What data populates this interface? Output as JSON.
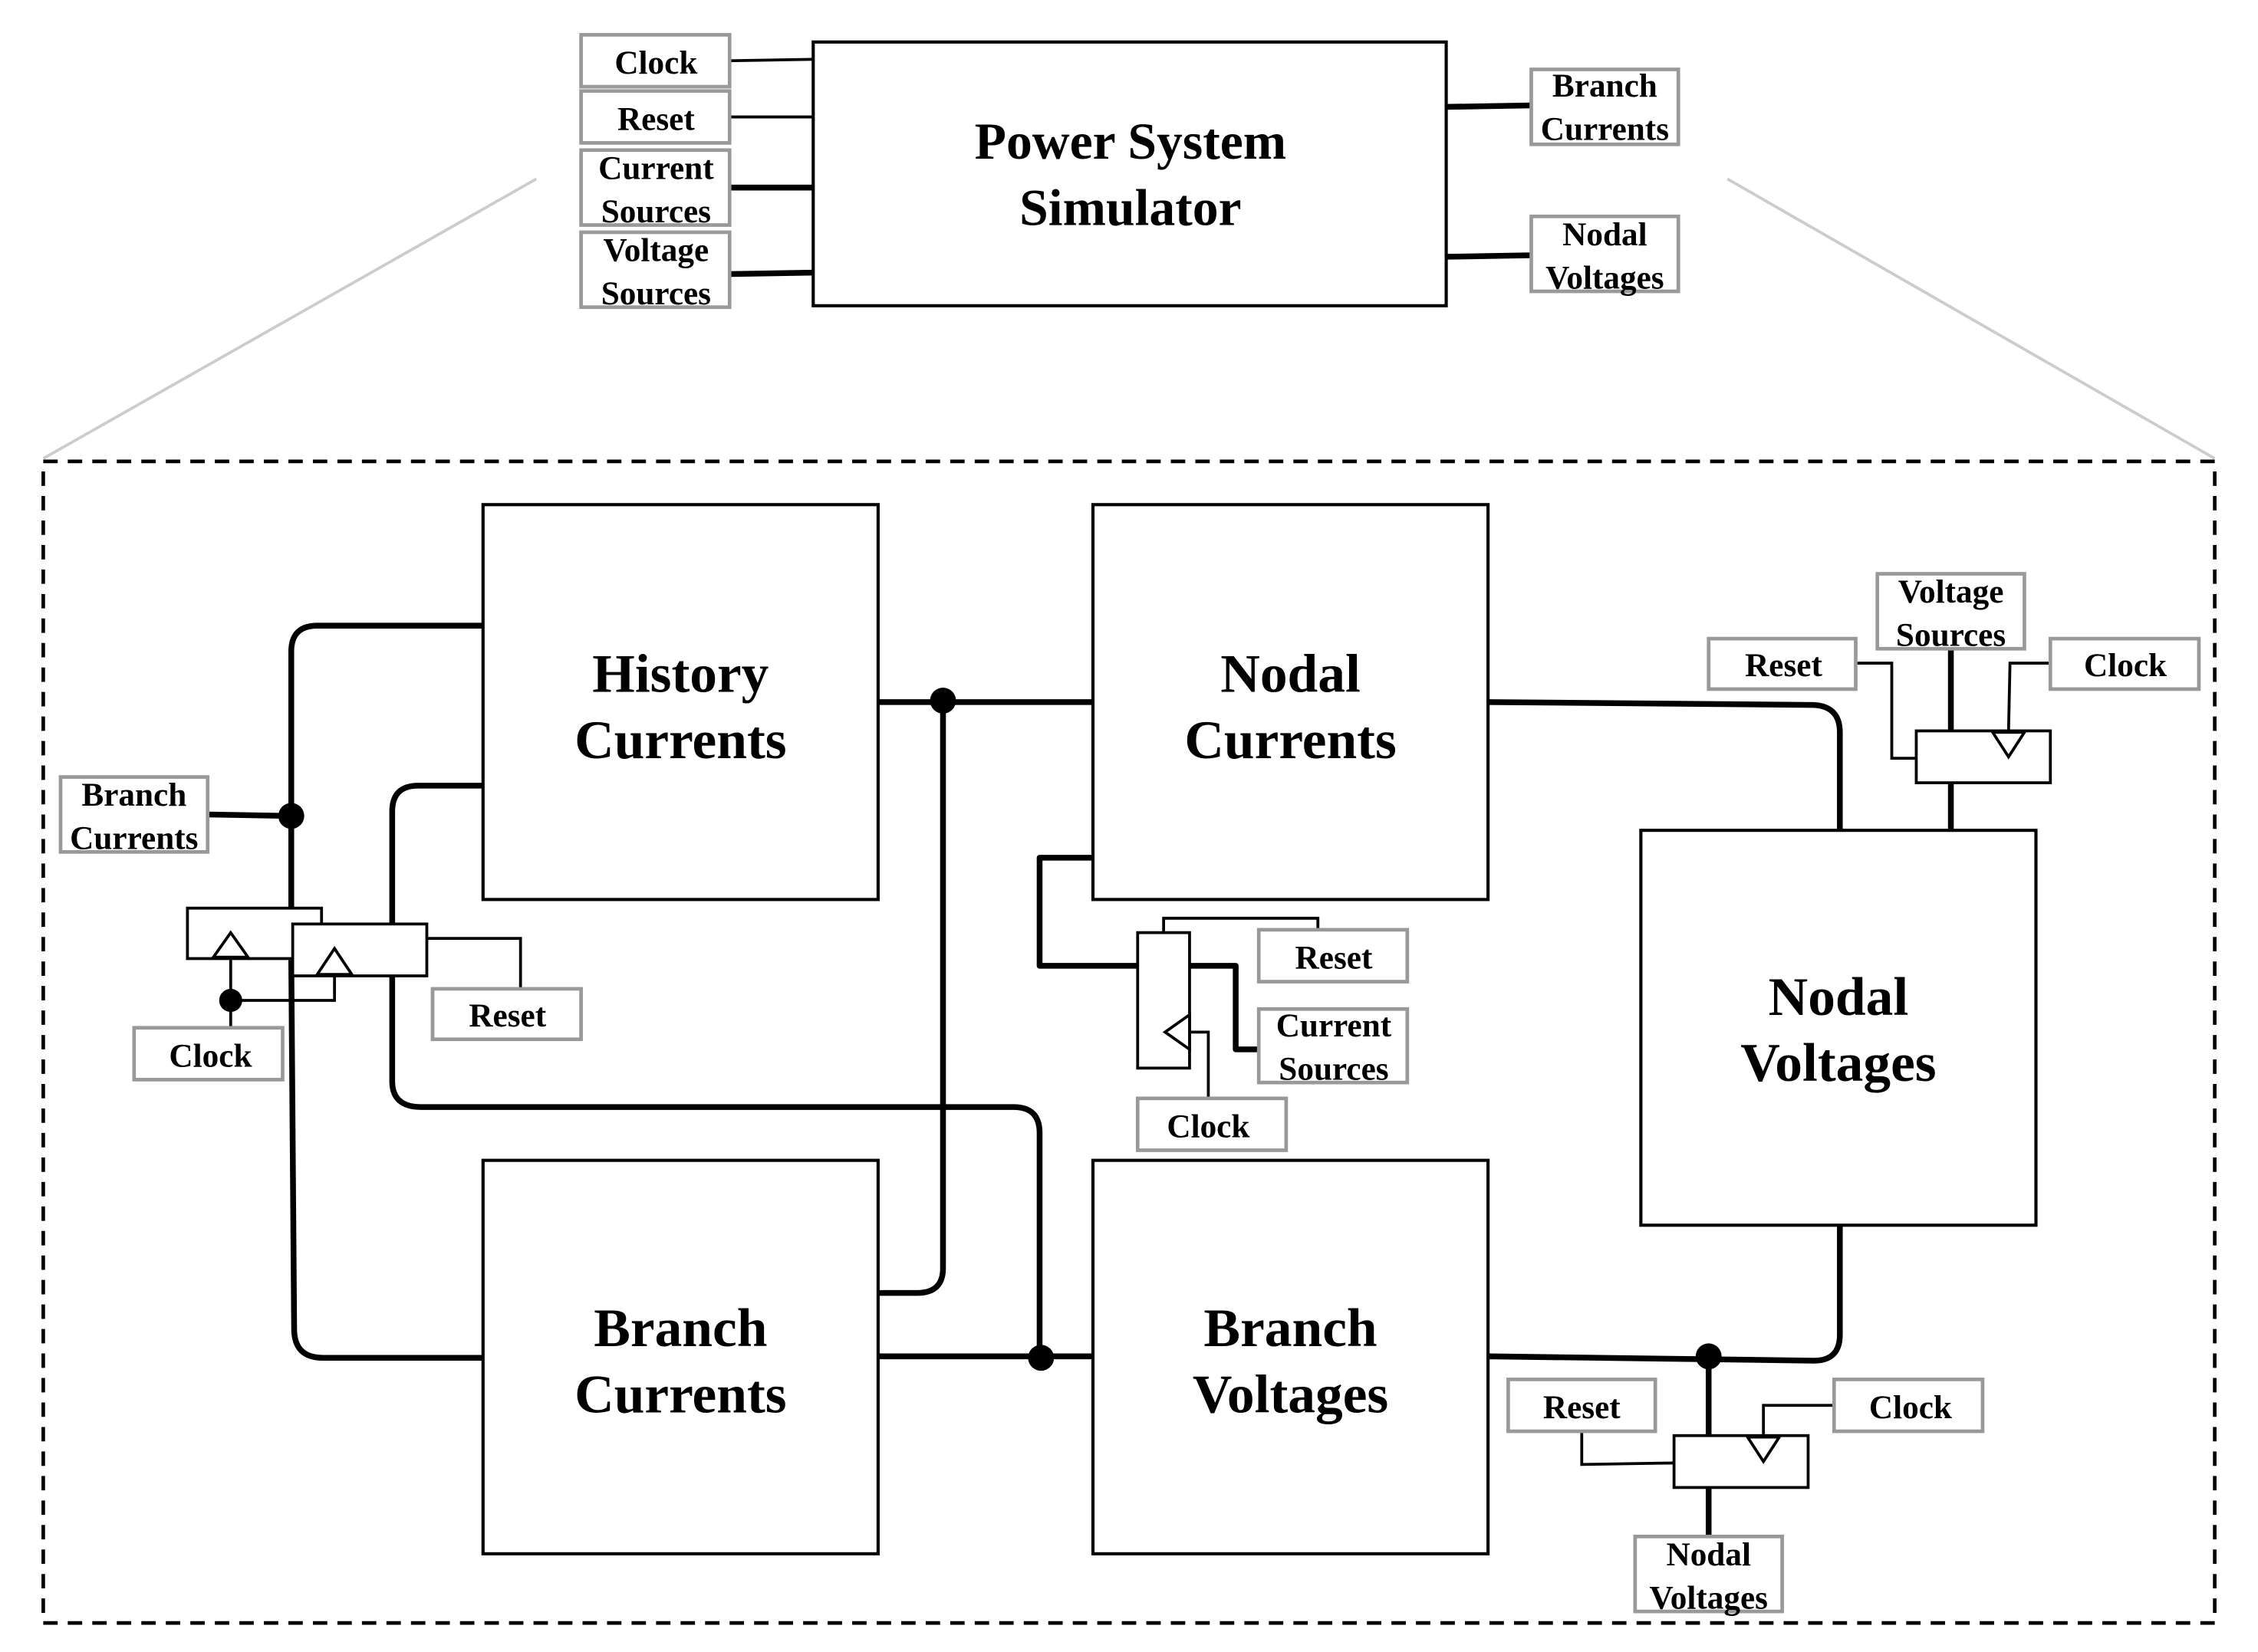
{
  "top": {
    "simulator_title_line1": "Power System",
    "simulator_title_line2": "Simulator",
    "inputs": [
      {
        "line1": "Clock",
        "line2": ""
      },
      {
        "line1": "Reset",
        "line2": ""
      },
      {
        "line1": "Current",
        "line2": "Sources"
      },
      {
        "line1": "Voltage",
        "line2": "Sources"
      }
    ],
    "outputs": [
      {
        "line1": "Branch",
        "line2": "Currents"
      },
      {
        "line1": "Nodal",
        "line2": "Voltages"
      }
    ]
  },
  "blocks": {
    "history_currents": {
      "line1": "History",
      "line2": "Currents"
    },
    "nodal_currents": {
      "line1": "Nodal",
      "line2": "Currents"
    },
    "branch_currents": {
      "line1": "Branch",
      "line2": "Currents"
    },
    "branch_voltages": {
      "line1": "Branch",
      "line2": "Voltages"
    },
    "nodal_voltages": {
      "line1": "Nodal",
      "line2": "Voltages"
    }
  },
  "tags": {
    "left_branch_currents": {
      "line1": "Branch",
      "line2": "Currents"
    },
    "left_clock": "Clock",
    "left_reset": "Reset",
    "mid_reset": "Reset",
    "mid_current_sources": {
      "line1": "Current",
      "line2": "Sources"
    },
    "mid_clock": "Clock",
    "right_top_voltage_sources": {
      "line1": "Voltage",
      "line2": "Sources"
    },
    "right_top_reset": "Reset",
    "right_top_clock": "Clock",
    "right_bottom_reset": "Reset",
    "right_bottom_clock": "Clock",
    "right_bottom_nodal_voltages": {
      "line1": "Nodal",
      "line2": "Voltages"
    }
  }
}
